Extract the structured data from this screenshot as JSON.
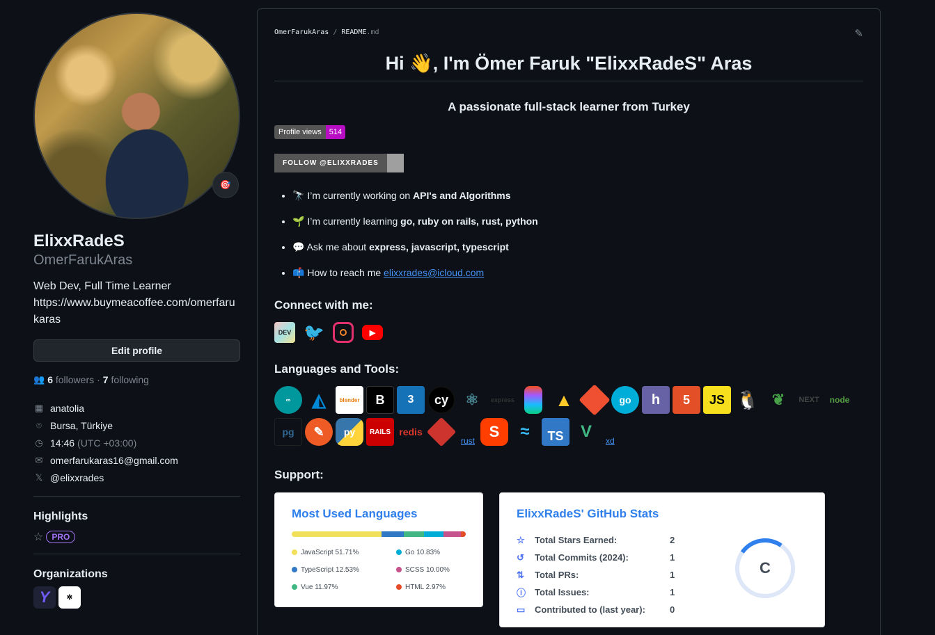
{
  "profile": {
    "emoji_badge": "🎯",
    "display_name": "ElixxRadeS",
    "login": "OmerFarukAras",
    "bio_line1": "Web Dev, Full Time Learner",
    "bio_line2": "https://www.buymeacoffee.com/omerfarukaras",
    "edit_label": "Edit profile",
    "followers_count": "6",
    "followers_label": "followers",
    "following_count": "7",
    "following_label": "following",
    "company": "anatolia",
    "location": "Bursa, Türkiye",
    "time": "14:46",
    "timezone": "(UTC +03:00)",
    "email": "omerfarukaras16@gmail.com",
    "twitter": "@elixxrades",
    "highlights_title": "Highlights",
    "pro_label": "PRO",
    "orgs_title": "Organizations",
    "org1_glyph": "Y",
    "org2_glyph": "✲"
  },
  "readme": {
    "crumb_user": "OmerFarukAras",
    "crumb_sep": "/",
    "crumb_file": "README",
    "crumb_ext": ".md",
    "heading": "Hi 👋, I'm Ömer Faruk \"ElixxRadeS\" Aras",
    "tagline": "A passionate full-stack learner from Turkey",
    "views_label": "Profile views",
    "views_count": "514",
    "follow_badge": "FOLLOW @ELIXXRADES",
    "bullets": [
      {
        "icon": "🔭",
        "text": "I’m currently working on ",
        "bold": "API's and Algorithms"
      },
      {
        "icon": "🌱",
        "text": "I’m currently learning ",
        "bold": "go, ruby on rails, rust, python"
      },
      {
        "icon": "💬",
        "text": "Ask me about ",
        "bold": "express, javascript, typescript"
      },
      {
        "icon": "📫",
        "text": "How to reach me ",
        "link": "elixxrades@icloud.com"
      }
    ],
    "connect_title": "Connect with me:",
    "social": [
      "DEV",
      "twitter",
      "instagram",
      "youtube"
    ],
    "tools_title": "Languages and Tools:",
    "tools_row1": [
      "arduino",
      "azure",
      "blender",
      "bootstrap",
      "css3",
      "cypress",
      "electron",
      "express",
      "figma",
      "firebase",
      "git",
      "go",
      "heroku",
      "html5",
      "javascript",
      "linux",
      "mongodb",
      "nextjs",
      "nodejs"
    ],
    "tools_row2": [
      "postgresql",
      "postman",
      "python",
      "rails",
      "redis",
      "ruby",
      "rust",
      "svelte",
      "tailwind",
      "typescript",
      "vuejs",
      "xd"
    ],
    "support_title": "Support:"
  },
  "lang_card": {
    "title": "Most Used Languages",
    "languages": [
      {
        "name": "JavaScript",
        "pct": "51.71%",
        "value": 51.71,
        "color": "#f1e05a"
      },
      {
        "name": "Go",
        "pct": "10.83%",
        "value": 10.83,
        "color": "#00ADD8"
      },
      {
        "name": "TypeScript",
        "pct": "12.53%",
        "value": 12.53,
        "color": "#3178c6"
      },
      {
        "name": "SCSS",
        "pct": "10.00%",
        "value": 10.0,
        "color": "#c6538c"
      },
      {
        "name": "Vue",
        "pct": "11.97%",
        "value": 11.97,
        "color": "#41b883"
      },
      {
        "name": "HTML",
        "pct": "2.97%",
        "value": 2.97,
        "color": "#e34c26"
      }
    ]
  },
  "stats_card": {
    "title": "ElixxRadeS' GitHub Stats",
    "rows": [
      {
        "icon": "☆",
        "label": "Total Stars Earned:",
        "value": "2"
      },
      {
        "icon": "↺",
        "label": "Total Commits (2024):",
        "value": "1"
      },
      {
        "icon": "⇅",
        "label": "Total PRs:",
        "value": "1"
      },
      {
        "icon": "ⓘ",
        "label": "Total Issues:",
        "value": "1"
      },
      {
        "icon": "▭",
        "label": "Contributed to (last year):",
        "value": "0"
      }
    ],
    "rank": "C"
  }
}
